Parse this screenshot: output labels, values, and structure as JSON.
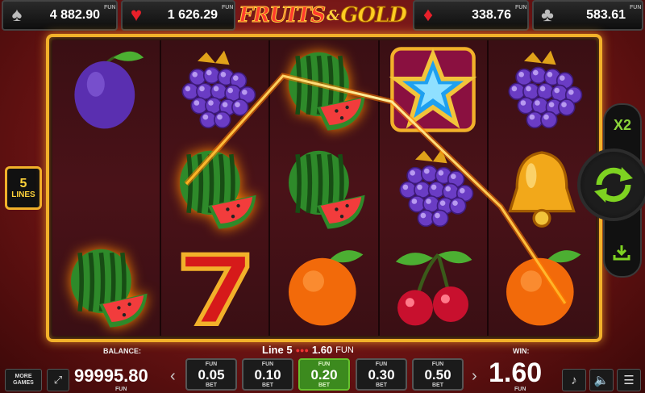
{
  "jackpots": [
    {
      "suit": "spade-icon",
      "glyph": "♠",
      "value": "4 882.90",
      "fun": "FUN"
    },
    {
      "suit": "heart-icon",
      "glyph": "♥",
      "value": "1 626.29",
      "fun": "FUN"
    },
    {
      "suit": "diamond-icon",
      "glyph": "♦",
      "value": "338.76",
      "fun": "FUN"
    },
    {
      "suit": "club-icon",
      "glyph": "♣",
      "value": "583.61",
      "fun": "FUN"
    }
  ],
  "logo": {
    "part1": "FRUITS",
    "amp": "&",
    "part2": "GOLD"
  },
  "lines_badge": {
    "number": "5",
    "label": "LINES"
  },
  "reels": [
    [
      "plum",
      "none",
      "burning-watermelon"
    ],
    [
      "grapes",
      "burning-watermelon",
      "seven"
    ],
    [
      "burning-watermelon",
      "watermelon",
      "orange"
    ],
    [
      "star",
      "grapes",
      "cherries"
    ],
    [
      "grapes",
      "bell",
      "orange"
    ]
  ],
  "side": {
    "multiplier": "X2"
  },
  "bottom": {
    "balance_label": "BALANCE:",
    "balance": "99995.80",
    "balance_fun": "FUN",
    "more_games": "MORE GAMES",
    "line_title": "Line 5",
    "line_win": "1.60",
    "line_fun": "FUN",
    "win_label": "WIN:",
    "win_value": "1.60",
    "win_fun": "FUN",
    "prev_arrow": "‹",
    "next_arrow": "›",
    "bets": [
      {
        "fun": "FUN",
        "value": "0.05",
        "bet": "BET",
        "selected": false
      },
      {
        "fun": "FUN",
        "value": "0.10",
        "bet": "BET",
        "selected": false
      },
      {
        "fun": "FUN",
        "value": "0.20",
        "bet": "BET",
        "selected": true
      },
      {
        "fun": "FUN",
        "value": "0.30",
        "bet": "BET",
        "selected": false
      },
      {
        "fun": "FUN",
        "value": "0.50",
        "bet": "BET",
        "selected": false
      }
    ]
  },
  "colors": {
    "gold": "#f2b12a",
    "green": "#66c22e",
    "red": "#e8202a"
  }
}
